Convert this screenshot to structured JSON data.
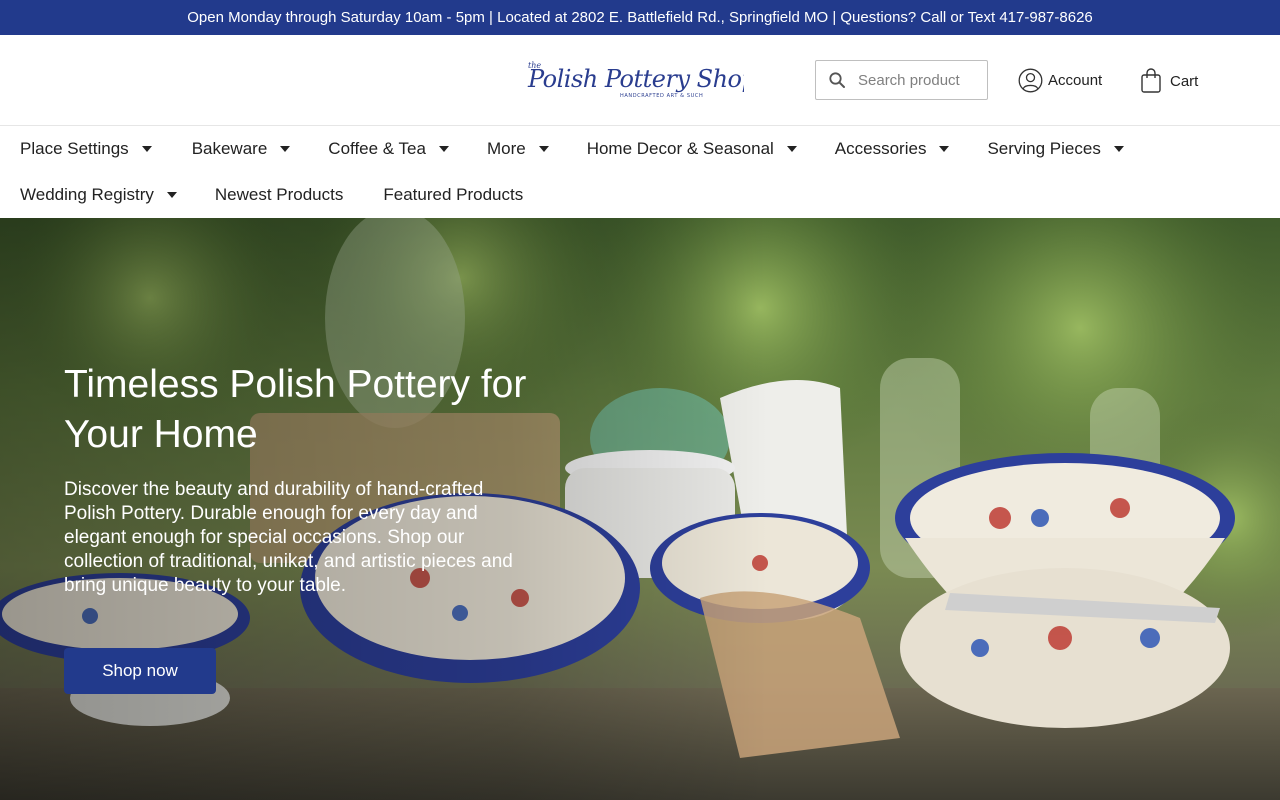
{
  "announcement": "Open Monday through Saturday 10am - 5pm | Located at 2802 E. Battlefield Rd., Springfield MO | Questions? Call or Text 417-987-8626",
  "brand": {
    "logo_text": "The Polish Pottery Shoppe",
    "logo_tagline": "HANDCRAFTED ART & SUCH"
  },
  "header": {
    "search_placeholder": "Search product",
    "search_icon": "search-icon",
    "account_label": "Account",
    "account_icon": "user-circle-icon",
    "cart_label": "Cart",
    "cart_icon": "shopping-bag-icon"
  },
  "nav": {
    "row1": [
      {
        "label": "Place Settings",
        "dropdown": true
      },
      {
        "label": "Bakeware",
        "dropdown": true
      },
      {
        "label": "Coffee & Tea",
        "dropdown": true
      },
      {
        "label": "More",
        "dropdown": true
      },
      {
        "label": "Home Decor & Seasonal",
        "dropdown": true
      },
      {
        "label": "Accessories",
        "dropdown": true
      },
      {
        "label": "Serving Pieces",
        "dropdown": true
      }
    ],
    "row2": [
      {
        "label": "Wedding Registry",
        "dropdown": true
      },
      {
        "label": "Newest Products",
        "dropdown": false
      },
      {
        "label": "Featured Products",
        "dropdown": false
      }
    ]
  },
  "hero": {
    "title": "Timeless Polish Pottery for Your Home",
    "text": "Discover the beauty and durability of hand-crafted Polish Pottery. Durable enough for every day and elegant enough for special occasions. Shop our collection of traditional, unikat, and artistic pieces and bring unique beauty to your table.",
    "button_label": "Shop now"
  },
  "colors": {
    "brand_blue": "#223a8c",
    "text": "#222222",
    "white": "#ffffff"
  }
}
